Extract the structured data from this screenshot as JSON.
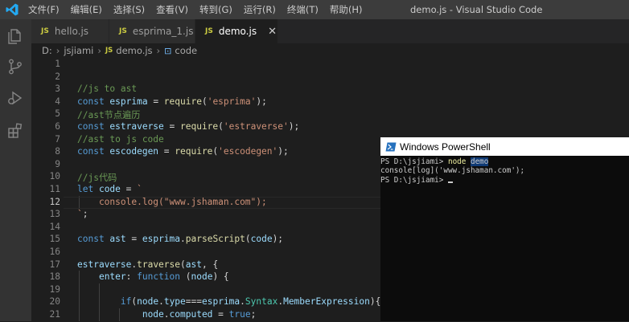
{
  "titlebar": {
    "menus": [
      "文件(F)",
      "编辑(E)",
      "选择(S)",
      "查看(V)",
      "转到(G)",
      "运行(R)",
      "终端(T)",
      "帮助(H)"
    ],
    "window_title": "demo.js - Visual Studio Code"
  },
  "tabs": [
    {
      "badge": "JS",
      "label": "hello.js",
      "active": false
    },
    {
      "badge": "JS",
      "label": "esprima_1.js",
      "active": false
    },
    {
      "badge": "JS",
      "label": "demo.js",
      "active": true
    }
  ],
  "tab_close_glyph": "✕",
  "breadcrumb": {
    "drive": "D:",
    "folder": "jsjiami",
    "file_badge": "JS",
    "file": "demo.js",
    "symbol_icon": "⊡",
    "symbol": "code"
  },
  "editor": {
    "current_line": 12,
    "lines": [
      {
        "n": "1",
        "t": [
          [
            "pl",
            ""
          ]
        ]
      },
      {
        "n": "2",
        "t": [
          [
            "pl",
            ""
          ]
        ]
      },
      {
        "n": "3",
        "t": [
          [
            "com",
            "//js to ast"
          ]
        ]
      },
      {
        "n": "4",
        "t": [
          [
            "kw",
            "const "
          ],
          [
            "var",
            "esprima"
          ],
          [
            "pl",
            " = "
          ],
          [
            "fn",
            "require"
          ],
          [
            "pl",
            "("
          ],
          [
            "str",
            "'esprima'"
          ],
          [
            "pl",
            ");"
          ]
        ]
      },
      {
        "n": "5",
        "t": [
          [
            "com",
            "//ast节点遍历"
          ]
        ]
      },
      {
        "n": "6",
        "t": [
          [
            "kw",
            "const "
          ],
          [
            "var",
            "estraverse"
          ],
          [
            "pl",
            " = "
          ],
          [
            "fn",
            "require"
          ],
          [
            "pl",
            "("
          ],
          [
            "str",
            "'estraverse'"
          ],
          [
            "pl",
            ");"
          ]
        ]
      },
      {
        "n": "7",
        "t": [
          [
            "com",
            "//ast to js code"
          ]
        ]
      },
      {
        "n": "8",
        "t": [
          [
            "kw",
            "const "
          ],
          [
            "var",
            "escodegen"
          ],
          [
            "pl",
            " = "
          ],
          [
            "fn",
            "require"
          ],
          [
            "pl",
            "("
          ],
          [
            "str",
            "'escodegen'"
          ],
          [
            "pl",
            ");"
          ]
        ]
      },
      {
        "n": "9",
        "t": [
          [
            "pl",
            ""
          ]
        ]
      },
      {
        "n": "10",
        "t": [
          [
            "com",
            "//js代码"
          ]
        ]
      },
      {
        "n": "11",
        "t": [
          [
            "kw",
            "let "
          ],
          [
            "var",
            "code"
          ],
          [
            "pl",
            " = "
          ],
          [
            "str",
            "`"
          ]
        ]
      },
      {
        "n": "12",
        "t": [
          [
            "str",
            "    console.log(\"www.jshaman.com\");"
          ]
        ]
      },
      {
        "n": "13",
        "t": [
          [
            "str",
            "`"
          ],
          [
            "pl",
            ";"
          ]
        ]
      },
      {
        "n": "14",
        "t": [
          [
            "pl",
            ""
          ]
        ]
      },
      {
        "n": "15",
        "t": [
          [
            "kw",
            "const "
          ],
          [
            "var",
            "ast"
          ],
          [
            "pl",
            " = "
          ],
          [
            "var",
            "esprima"
          ],
          [
            "pl",
            "."
          ],
          [
            "fn",
            "parseScript"
          ],
          [
            "pl",
            "("
          ],
          [
            "var",
            "code"
          ],
          [
            "pl",
            ");"
          ]
        ]
      },
      {
        "n": "16",
        "t": [
          [
            "pl",
            ""
          ]
        ]
      },
      {
        "n": "17",
        "t": [
          [
            "var",
            "estraverse"
          ],
          [
            "pl",
            "."
          ],
          [
            "fn",
            "traverse"
          ],
          [
            "pl",
            "("
          ],
          [
            "var",
            "ast"
          ],
          [
            "pl",
            ", {"
          ]
        ]
      },
      {
        "n": "18",
        "t": [
          [
            "pl",
            "    "
          ],
          [
            "var",
            "enter"
          ],
          [
            "pl",
            ": "
          ],
          [
            "kw",
            "function"
          ],
          [
            "pl",
            " ("
          ],
          [
            "var",
            "node"
          ],
          [
            "pl",
            ") {"
          ]
        ]
      },
      {
        "n": "19",
        "t": [
          [
            "pl",
            ""
          ]
        ]
      },
      {
        "n": "20",
        "t": [
          [
            "pl",
            "        "
          ],
          [
            "kw",
            "if"
          ],
          [
            "pl",
            "("
          ],
          [
            "var",
            "node"
          ],
          [
            "pl",
            "."
          ],
          [
            "var",
            "type"
          ],
          [
            "pl",
            "==="
          ],
          [
            "var",
            "esprima"
          ],
          [
            "pl",
            "."
          ],
          [
            "cls",
            "Syntax"
          ],
          [
            "pl",
            "."
          ],
          [
            "var",
            "MemberExpression"
          ],
          [
            "pl",
            "){"
          ]
        ]
      },
      {
        "n": "21",
        "t": [
          [
            "pl",
            "            "
          ],
          [
            "var",
            "node"
          ],
          [
            "pl",
            "."
          ],
          [
            "var",
            "computed"
          ],
          [
            "pl",
            " = "
          ],
          [
            "kw",
            "true"
          ],
          [
            "pl",
            ";"
          ]
        ]
      }
    ]
  },
  "powershell": {
    "title": "Windows PowerShell",
    "lines": [
      {
        "prompt": "PS D:\\jsjiami> ",
        "cmd": "node ",
        "arg": "demo"
      },
      {
        "out": "console[log]('www.jshaman.com');"
      },
      {
        "prompt": "PS D:\\jsjiami> ",
        "cursor": true
      }
    ]
  }
}
